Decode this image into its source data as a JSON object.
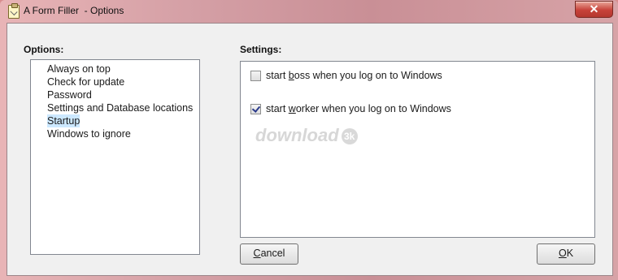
{
  "window": {
    "title": "A Form Filler  - Options",
    "close_glyph": "✕"
  },
  "options": {
    "heading": "Options:",
    "items": [
      {
        "label": "Always on top",
        "selected": false
      },
      {
        "label": "Check for update",
        "selected": false
      },
      {
        "label": "Password",
        "selected": false
      },
      {
        "label": "Settings and Database locations",
        "selected": false
      },
      {
        "label": "Startup",
        "selected": true
      },
      {
        "label": "Windows to ignore",
        "selected": false
      }
    ]
  },
  "settings": {
    "heading": "Settings:",
    "boss": {
      "pre": "start ",
      "accel": "b",
      "post": "oss when you log on to Windows",
      "checked": false
    },
    "worker": {
      "pre": "start ",
      "accel": "w",
      "post": "orker when you log on to Windows",
      "checked": true
    },
    "watermark": {
      "text": "download",
      "badge": "3k"
    }
  },
  "buttons": {
    "cancel": {
      "accel": "C",
      "rest": "ancel"
    },
    "ok": {
      "accel": "O",
      "rest": "K"
    }
  },
  "icons": {
    "app": "clipboard-icon",
    "close": "close-icon"
  }
}
